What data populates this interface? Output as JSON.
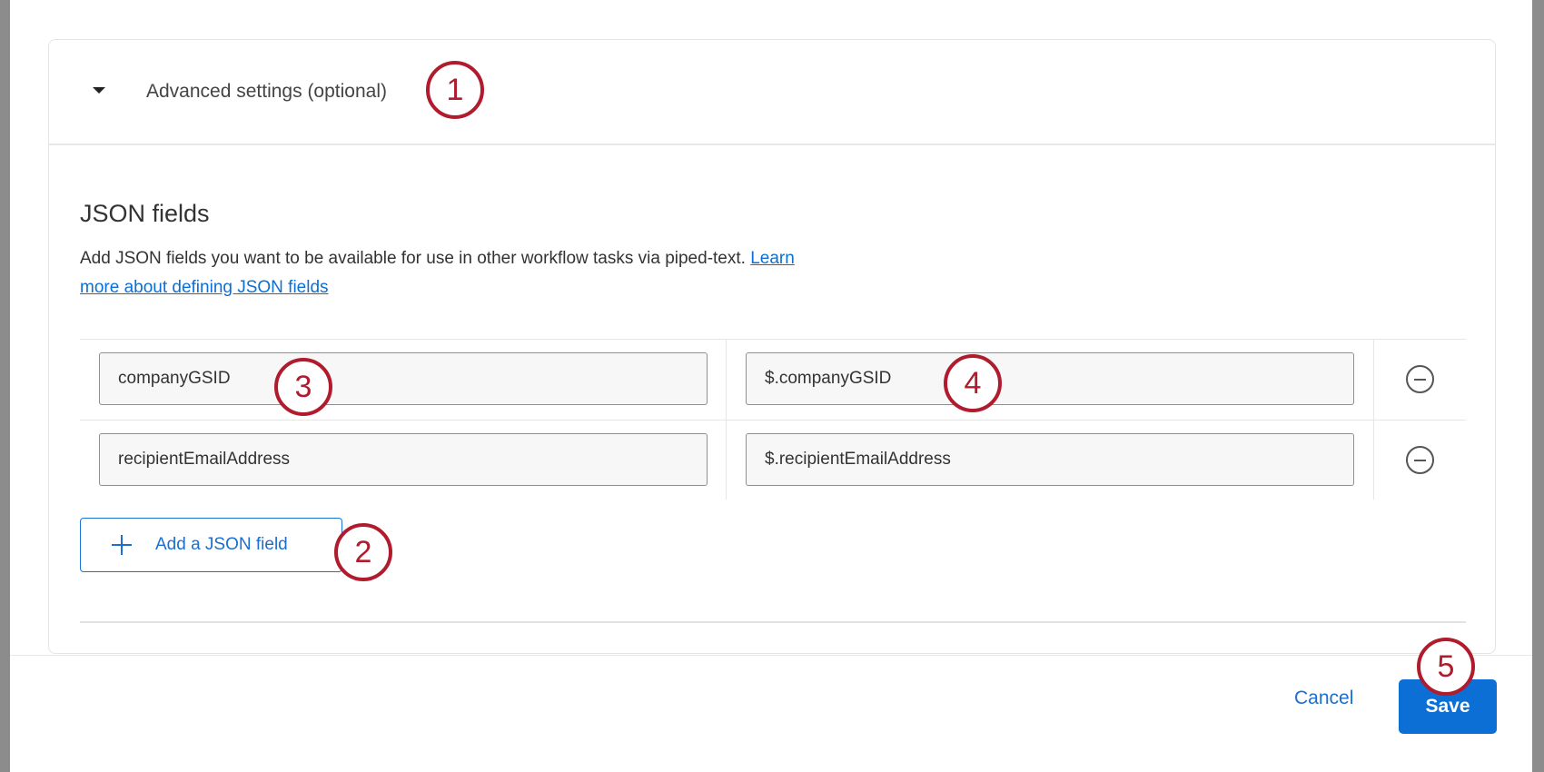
{
  "section": {
    "title": "Advanced settings (optional)"
  },
  "json_fields": {
    "heading": "JSON fields",
    "description": "Add JSON fields you want to be available for use in other workflow tasks via piped-text.",
    "link": "Learn more about defining JSON fields",
    "rows": [
      {
        "name": "companyGSID",
        "path": "$.companyGSID"
      },
      {
        "name": "recipientEmailAddress",
        "path": "$.recipientEmailAddress"
      }
    ],
    "add_label": "Add a JSON field"
  },
  "footer": {
    "cancel": "Cancel",
    "save": "Save"
  },
  "callouts": [
    "1",
    "2",
    "3",
    "4",
    "5"
  ],
  "colors": {
    "accent": "#0b6fd6",
    "callout": "#b01c2e"
  }
}
